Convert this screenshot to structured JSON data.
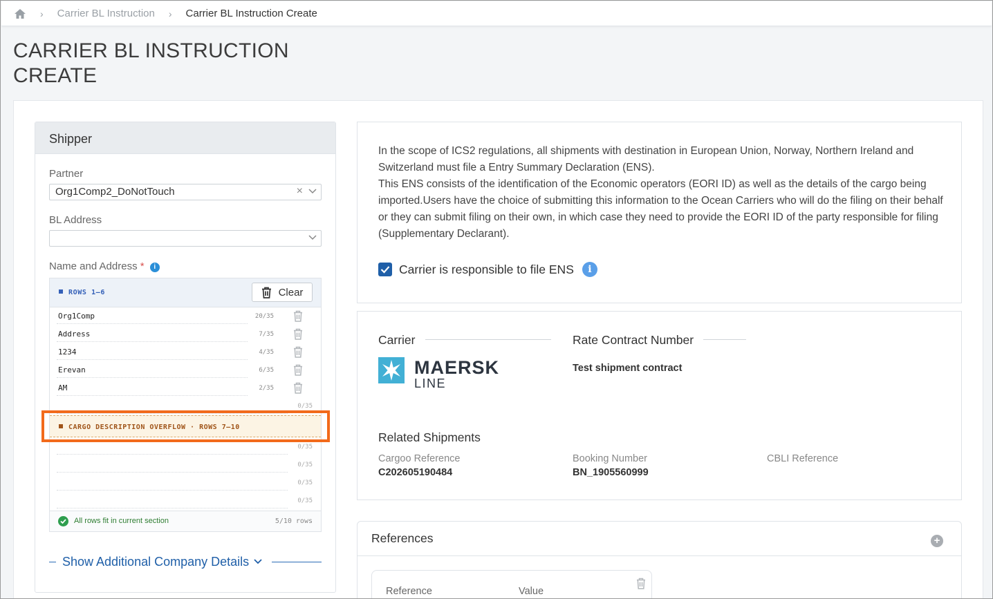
{
  "breadcrumb": {
    "items": [
      "Carrier BL Instruction",
      "Carrier BL Instruction Create"
    ]
  },
  "page": {
    "title": "CARRIER BL INSTRUCTION CREATE"
  },
  "shipper": {
    "title": "Shipper",
    "partner_label": "Partner",
    "partner_value": "Org1Comp2_DoNotTouch",
    "bl_address_label": "BL Address",
    "bl_address_value": "",
    "name_address_label": "Name and Address",
    "required_mark": "*",
    "rows_tag": "ROWS 1–6",
    "clear_label": "Clear",
    "rows": [
      {
        "value": "Org1Comp",
        "count": "20/35"
      },
      {
        "value": "Address",
        "count": "7/35"
      },
      {
        "value": "1234",
        "count": "4/35"
      },
      {
        "value": "Erevan",
        "count": "6/35"
      },
      {
        "value": "AM",
        "count": "2/35"
      },
      {
        "value": "",
        "count": "0/35"
      }
    ],
    "overflow_tag": "CARGO DESCRIPTION OVERFLOW · ROWS 7–10",
    "overflow_rows": [
      {
        "value": "",
        "count": "0/35"
      },
      {
        "value": "",
        "count": "0/35"
      },
      {
        "value": "",
        "count": "0/35"
      },
      {
        "value": "",
        "count": "0/35"
      }
    ],
    "status_text": "All rows fit in current section",
    "rows_used": "5/10 rows",
    "show_more": "Show Additional Company Details"
  },
  "ens": {
    "text": "In the scope of ICS2 regulations, all shipments with destination in European Union, Norway, Northern Ireland and Switzerland must file a Entry Summary Declaration (ENS).\nThis ENS consists of the identification of the Economic operators (EORI ID) as well as the details of the cargo being imported.Users have the choice of submitting this information to the Ocean Carriers who will do the filing on their behalf or they can submit filing on their own, in which case they need to provide the EORI ID of the party responsible for filing (Supplementary Declarant).",
    "checkbox_label": "Carrier is responsible to file ENS",
    "checked": true
  },
  "carrier": {
    "carrier_heading": "Carrier",
    "logo_word1": "MAERSK",
    "logo_word2": "LINE",
    "rate_heading": "Rate Contract Number",
    "rate_value": "Test shipment contract",
    "related_heading": "Related Shipments",
    "cargoo_label": "Cargoo Reference",
    "cargoo_value": "C202605190484",
    "booking_label": "Booking Number",
    "booking_value": "BN_1905560999",
    "cbli_label": "CBLI Reference",
    "cbli_value": ""
  },
  "references": {
    "title": "References",
    "col_reference": "Reference",
    "col_value": "Value"
  },
  "colors": {
    "accent": "#1f5fa8",
    "highlight": "#f26a1b",
    "success": "#2e9e4e"
  }
}
